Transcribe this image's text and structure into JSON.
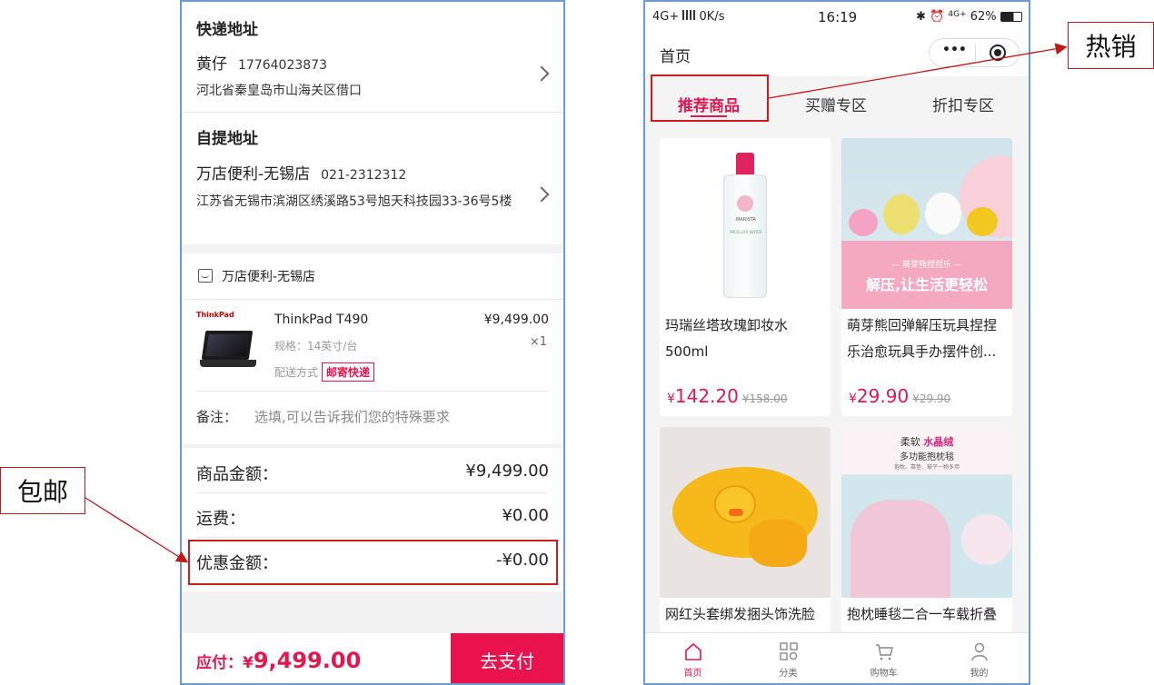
{
  "left": {
    "courier_title": "快递地址",
    "courier_name": "黄仔",
    "courier_phone": "17764023873",
    "courier_address": "河北省秦皇岛市山海关区借口",
    "pickup_title": "自提地址",
    "pickup_name": "万店便利-无锡店",
    "pickup_phone": "021-2312312",
    "pickup_address": "江苏省无锡市滨湖区绣溪路53号旭天科技园33-36号5楼",
    "store_name": "万店便利-无锡店",
    "product": {
      "brand_mark": "ThinkPad",
      "name": "ThinkPad T490",
      "price": "¥9,499.00",
      "spec": "规格：14英寸/台",
      "qty": "×1",
      "shipping_label": "配送方式",
      "shipping_tag": "邮寄快递"
    },
    "remark_label": "备注：",
    "remark_placeholder": "选填,可以告诉我们您的特殊要求",
    "summary": [
      {
        "label": "商品金额：",
        "value": "¥9,499.00"
      },
      {
        "label": "运费：",
        "value": "¥0.00"
      },
      {
        "label": "优惠金额：",
        "value": "-¥0.00"
      }
    ],
    "total_label": "应付：",
    "total_yen": "¥",
    "total_value": "9,499.00",
    "pay_button": "去支付"
  },
  "right": {
    "status": {
      "network": "4G+",
      "speed": "0K/s",
      "time": "16:19",
      "net2": "4G+",
      "battery": "62%"
    },
    "nav_title": "首页",
    "capsule_more": "•••",
    "tabs": [
      "推荐商品",
      "买赠专区",
      "折扣专区"
    ],
    "products": [
      {
        "title": "玛瑞丝塔玫瑰卸妆水500ml",
        "price_yen": "¥",
        "price": "142.20",
        "old": "¥158.00",
        "label": "MARISTA",
        "label2": "MICELLAR WATER"
      },
      {
        "title": "萌芽熊回弹解压玩具捏捏乐治愈玩具手办摆件创...",
        "price_yen": "¥",
        "price": "29.90",
        "old": "¥29.90",
        "banner_small": "— 萌芽熊捏捏乐 —",
        "banner": "解压,让生活更轻松"
      },
      {
        "title": "网红头套绑发捆头饰洗脸敷面膜束发带箍的发箍...",
        "price_yen": "",
        "price": "",
        "old": ""
      },
      {
        "title": "抱枕睡毯二合一车载折叠午睡办公室被子...",
        "price_yen": "",
        "price": "",
        "old": "",
        "banner_a": "柔软",
        "banner_b": "水晶绒",
        "banner_c": "多功能抱枕毯",
        "banner_d": "抱枕、靠垫、被子一物多用"
      }
    ],
    "tabbar": [
      "首页",
      "分类",
      "购物车",
      "我的"
    ]
  },
  "callouts": {
    "free_shipping": "包邮",
    "hot_sale": "热销"
  },
  "colors": {
    "accent": "#e2174f",
    "annotation": "#d11a1a"
  }
}
